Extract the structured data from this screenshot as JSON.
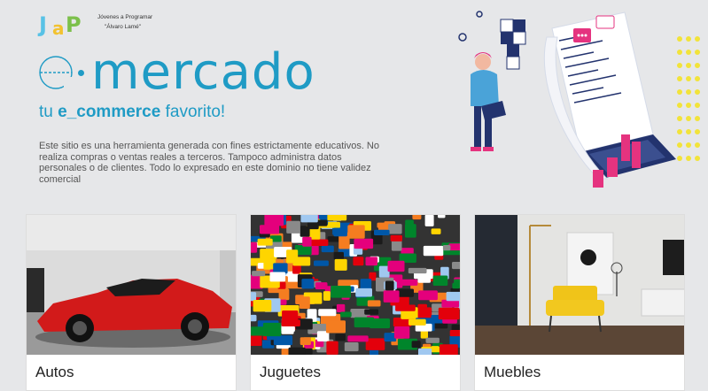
{
  "logo": {
    "mark": "JaP",
    "line1": "Jóvenes a Programar",
    "line2": "\"Álvaro Lamé\""
  },
  "brand": {
    "word": "mercado",
    "tagline_prefix": "tu ",
    "tagline_bold": "e_commerce",
    "tagline_suffix": " favorito!"
  },
  "disclaimer": "Este sitio  es una herramienta generada con fines estrictamente educativos. No realiza compras o ventas reales a terceros. Tampoco administra datos personales o de clientes. Todo lo expresado en este dominio no tiene validez comercial",
  "categories": [
    {
      "label": "Autos"
    },
    {
      "label": "Juguetes"
    },
    {
      "label": "Muebles"
    }
  ],
  "colors": {
    "brand": "#1f9bc5",
    "pink": "#e5337f",
    "navy": "#23336e",
    "yellow": "#f2e33a"
  }
}
